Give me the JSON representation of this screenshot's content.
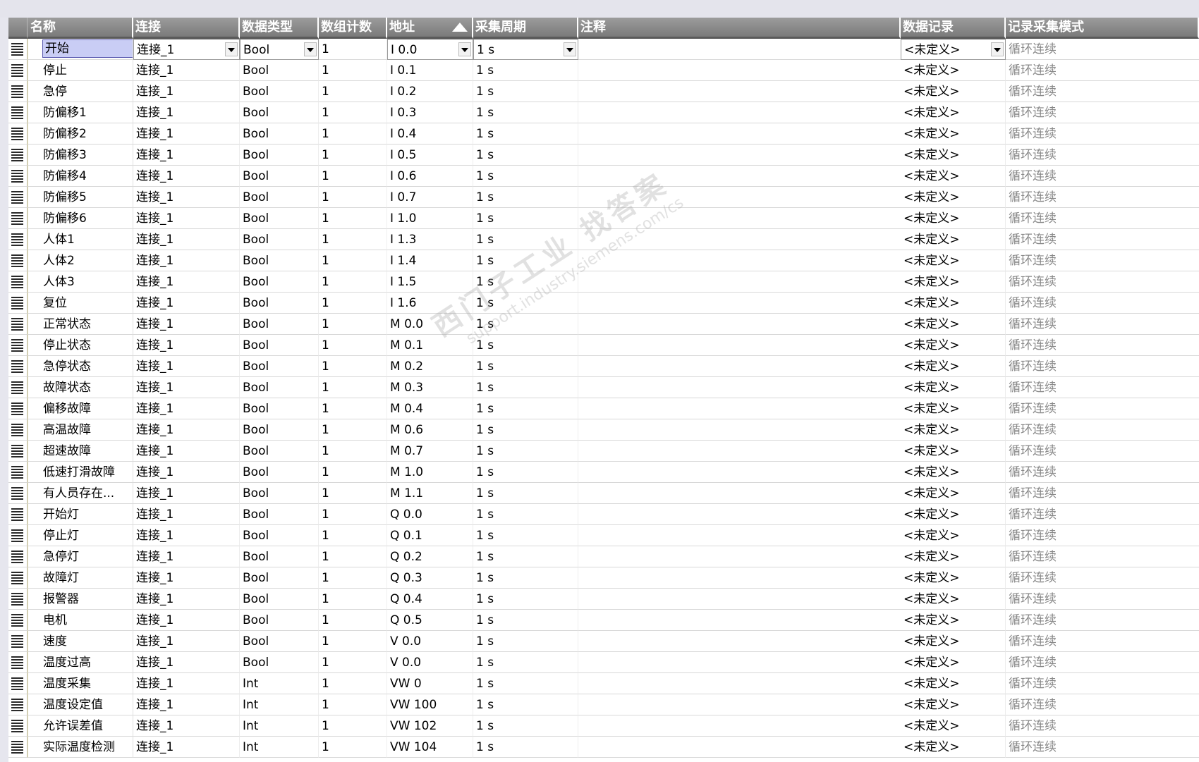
{
  "headers": {
    "name": "名称",
    "connection": "连接",
    "data_type": "数据类型",
    "array_count": "数组计数",
    "address": "地址",
    "acq_cycle": "采集周期",
    "comment": "注释",
    "logging": "数据记录",
    "log_mode": "记录采集模式"
  },
  "sort": {
    "column": "address",
    "direction": "ascending"
  },
  "watermark": {
    "line1": "西门子工业 找答案",
    "line2": "support.industry.siemens.com/cs"
  },
  "rows": [
    {
      "name": "开始",
      "connection": "连接_1",
      "data_type": "Bool",
      "count": "1",
      "address": "I 0.0",
      "cycle": "1 s",
      "comment": "",
      "logging": "<未定义>",
      "mode": "循环连续"
    },
    {
      "name": "停止",
      "connection": "连接_1",
      "data_type": "Bool",
      "count": "1",
      "address": "I 0.1",
      "cycle": "1 s",
      "comment": "",
      "logging": "<未定义>",
      "mode": "循环连续"
    },
    {
      "name": "急停",
      "connection": "连接_1",
      "data_type": "Bool",
      "count": "1",
      "address": "I 0.2",
      "cycle": "1 s",
      "comment": "",
      "logging": "<未定义>",
      "mode": "循环连续"
    },
    {
      "name": "防偏移1",
      "connection": "连接_1",
      "data_type": "Bool",
      "count": "1",
      "address": "I 0.3",
      "cycle": "1 s",
      "comment": "",
      "logging": "<未定义>",
      "mode": "循环连续"
    },
    {
      "name": "防偏移2",
      "connection": "连接_1",
      "data_type": "Bool",
      "count": "1",
      "address": "I 0.4",
      "cycle": "1 s",
      "comment": "",
      "logging": "<未定义>",
      "mode": "循环连续"
    },
    {
      "name": "防偏移3",
      "connection": "连接_1",
      "data_type": "Bool",
      "count": "1",
      "address": "I 0.5",
      "cycle": "1 s",
      "comment": "",
      "logging": "<未定义>",
      "mode": "循环连续"
    },
    {
      "name": "防偏移4",
      "connection": "连接_1",
      "data_type": "Bool",
      "count": "1",
      "address": "I 0.6",
      "cycle": "1 s",
      "comment": "",
      "logging": "<未定义>",
      "mode": "循环连续"
    },
    {
      "name": "防偏移5",
      "connection": "连接_1",
      "data_type": "Bool",
      "count": "1",
      "address": "I 0.7",
      "cycle": "1 s",
      "comment": "",
      "logging": "<未定义>",
      "mode": "循环连续"
    },
    {
      "name": "防偏移6",
      "connection": "连接_1",
      "data_type": "Bool",
      "count": "1",
      "address": "I 1.0",
      "cycle": "1 s",
      "comment": "",
      "logging": "<未定义>",
      "mode": "循环连续"
    },
    {
      "name": "人体1",
      "connection": "连接_1",
      "data_type": "Bool",
      "count": "1",
      "address": "I 1.3",
      "cycle": "1 s",
      "comment": "",
      "logging": "<未定义>",
      "mode": "循环连续"
    },
    {
      "name": "人体2",
      "connection": "连接_1",
      "data_type": "Bool",
      "count": "1",
      "address": "I 1.4",
      "cycle": "1 s",
      "comment": "",
      "logging": "<未定义>",
      "mode": "循环连续"
    },
    {
      "name": "人体3",
      "connection": "连接_1",
      "data_type": "Bool",
      "count": "1",
      "address": "I 1.5",
      "cycle": "1 s",
      "comment": "",
      "logging": "<未定义>",
      "mode": "循环连续"
    },
    {
      "name": "复位",
      "connection": "连接_1",
      "data_type": "Bool",
      "count": "1",
      "address": "I 1.6",
      "cycle": "1 s",
      "comment": "",
      "logging": "<未定义>",
      "mode": "循环连续"
    },
    {
      "name": "正常状态",
      "connection": "连接_1",
      "data_type": "Bool",
      "count": "1",
      "address": "M 0.0",
      "cycle": "1 s",
      "comment": "",
      "logging": "<未定义>",
      "mode": "循环连续"
    },
    {
      "name": "停止状态",
      "connection": "连接_1",
      "data_type": "Bool",
      "count": "1",
      "address": "M 0.1",
      "cycle": "1 s",
      "comment": "",
      "logging": "<未定义>",
      "mode": "循环连续"
    },
    {
      "name": "急停状态",
      "connection": "连接_1",
      "data_type": "Bool",
      "count": "1",
      "address": "M 0.2",
      "cycle": "1 s",
      "comment": "",
      "logging": "<未定义>",
      "mode": "循环连续"
    },
    {
      "name": "故障状态",
      "connection": "连接_1",
      "data_type": "Bool",
      "count": "1",
      "address": "M 0.3",
      "cycle": "1 s",
      "comment": "",
      "logging": "<未定义>",
      "mode": "循环连续"
    },
    {
      "name": "偏移故障",
      "connection": "连接_1",
      "data_type": "Bool",
      "count": "1",
      "address": "M 0.4",
      "cycle": "1 s",
      "comment": "",
      "logging": "<未定义>",
      "mode": "循环连续"
    },
    {
      "name": "高温故障",
      "connection": "连接_1",
      "data_type": "Bool",
      "count": "1",
      "address": "M 0.6",
      "cycle": "1 s",
      "comment": "",
      "logging": "<未定义>",
      "mode": "循环连续"
    },
    {
      "name": "超速故障",
      "connection": "连接_1",
      "data_type": "Bool",
      "count": "1",
      "address": "M 0.7",
      "cycle": "1 s",
      "comment": "",
      "logging": "<未定义>",
      "mode": "循环连续"
    },
    {
      "name": "低速打滑故障",
      "connection": "连接_1",
      "data_type": "Bool",
      "count": "1",
      "address": "M 1.0",
      "cycle": "1 s",
      "comment": "",
      "logging": "<未定义>",
      "mode": "循环连续"
    },
    {
      "name": "有人员存在...",
      "connection": "连接_1",
      "data_type": "Bool",
      "count": "1",
      "address": "M 1.1",
      "cycle": "1 s",
      "comment": "",
      "logging": "<未定义>",
      "mode": "循环连续"
    },
    {
      "name": "开始灯",
      "connection": "连接_1",
      "data_type": "Bool",
      "count": "1",
      "address": "Q 0.0",
      "cycle": "1 s",
      "comment": "",
      "logging": "<未定义>",
      "mode": "循环连续"
    },
    {
      "name": "停止灯",
      "connection": "连接_1",
      "data_type": "Bool",
      "count": "1",
      "address": "Q 0.1",
      "cycle": "1 s",
      "comment": "",
      "logging": "<未定义>",
      "mode": "循环连续"
    },
    {
      "name": "急停灯",
      "connection": "连接_1",
      "data_type": "Bool",
      "count": "1",
      "address": "Q 0.2",
      "cycle": "1 s",
      "comment": "",
      "logging": "<未定义>",
      "mode": "循环连续"
    },
    {
      "name": "故障灯",
      "connection": "连接_1",
      "data_type": "Bool",
      "count": "1",
      "address": "Q 0.3",
      "cycle": "1 s",
      "comment": "",
      "logging": "<未定义>",
      "mode": "循环连续"
    },
    {
      "name": "报警器",
      "connection": "连接_1",
      "data_type": "Bool",
      "count": "1",
      "address": "Q 0.4",
      "cycle": "1 s",
      "comment": "",
      "logging": "<未定义>",
      "mode": "循环连续"
    },
    {
      "name": "电机",
      "connection": "连接_1",
      "data_type": "Bool",
      "count": "1",
      "address": "Q 0.5",
      "cycle": "1 s",
      "comment": "",
      "logging": "<未定义>",
      "mode": "循环连续"
    },
    {
      "name": "速度",
      "connection": "连接_1",
      "data_type": "Bool",
      "count": "1",
      "address": "V 0.0",
      "cycle": "1 s",
      "comment": "",
      "logging": "<未定义>",
      "mode": "循环连续"
    },
    {
      "name": "温度过高",
      "connection": "连接_1",
      "data_type": "Bool",
      "count": "1",
      "address": "V 0.0",
      "cycle": "1 s",
      "comment": "",
      "logging": "<未定义>",
      "mode": "循环连续"
    },
    {
      "name": "温度采集",
      "connection": "连接_1",
      "data_type": "Int",
      "count": "1",
      "address": "VW 0",
      "cycle": "1 s",
      "comment": "",
      "logging": "<未定义>",
      "mode": "循环连续"
    },
    {
      "name": "温度设定值",
      "connection": "连接_1",
      "data_type": "Int",
      "count": "1",
      "address": "VW 100",
      "cycle": "1 s",
      "comment": "",
      "logging": "<未定义>",
      "mode": "循环连续"
    },
    {
      "name": "允许误差值",
      "connection": "连接_1",
      "data_type": "Int",
      "count": "1",
      "address": "VW 102",
      "cycle": "1 s",
      "comment": "",
      "logging": "<未定义>",
      "mode": "循环连续"
    },
    {
      "name": "实际温度检测",
      "connection": "连接_1",
      "data_type": "Int",
      "count": "1",
      "address": "VW 104",
      "cycle": "1 s",
      "comment": "",
      "logging": "<未定义>",
      "mode": "循环连续"
    }
  ]
}
